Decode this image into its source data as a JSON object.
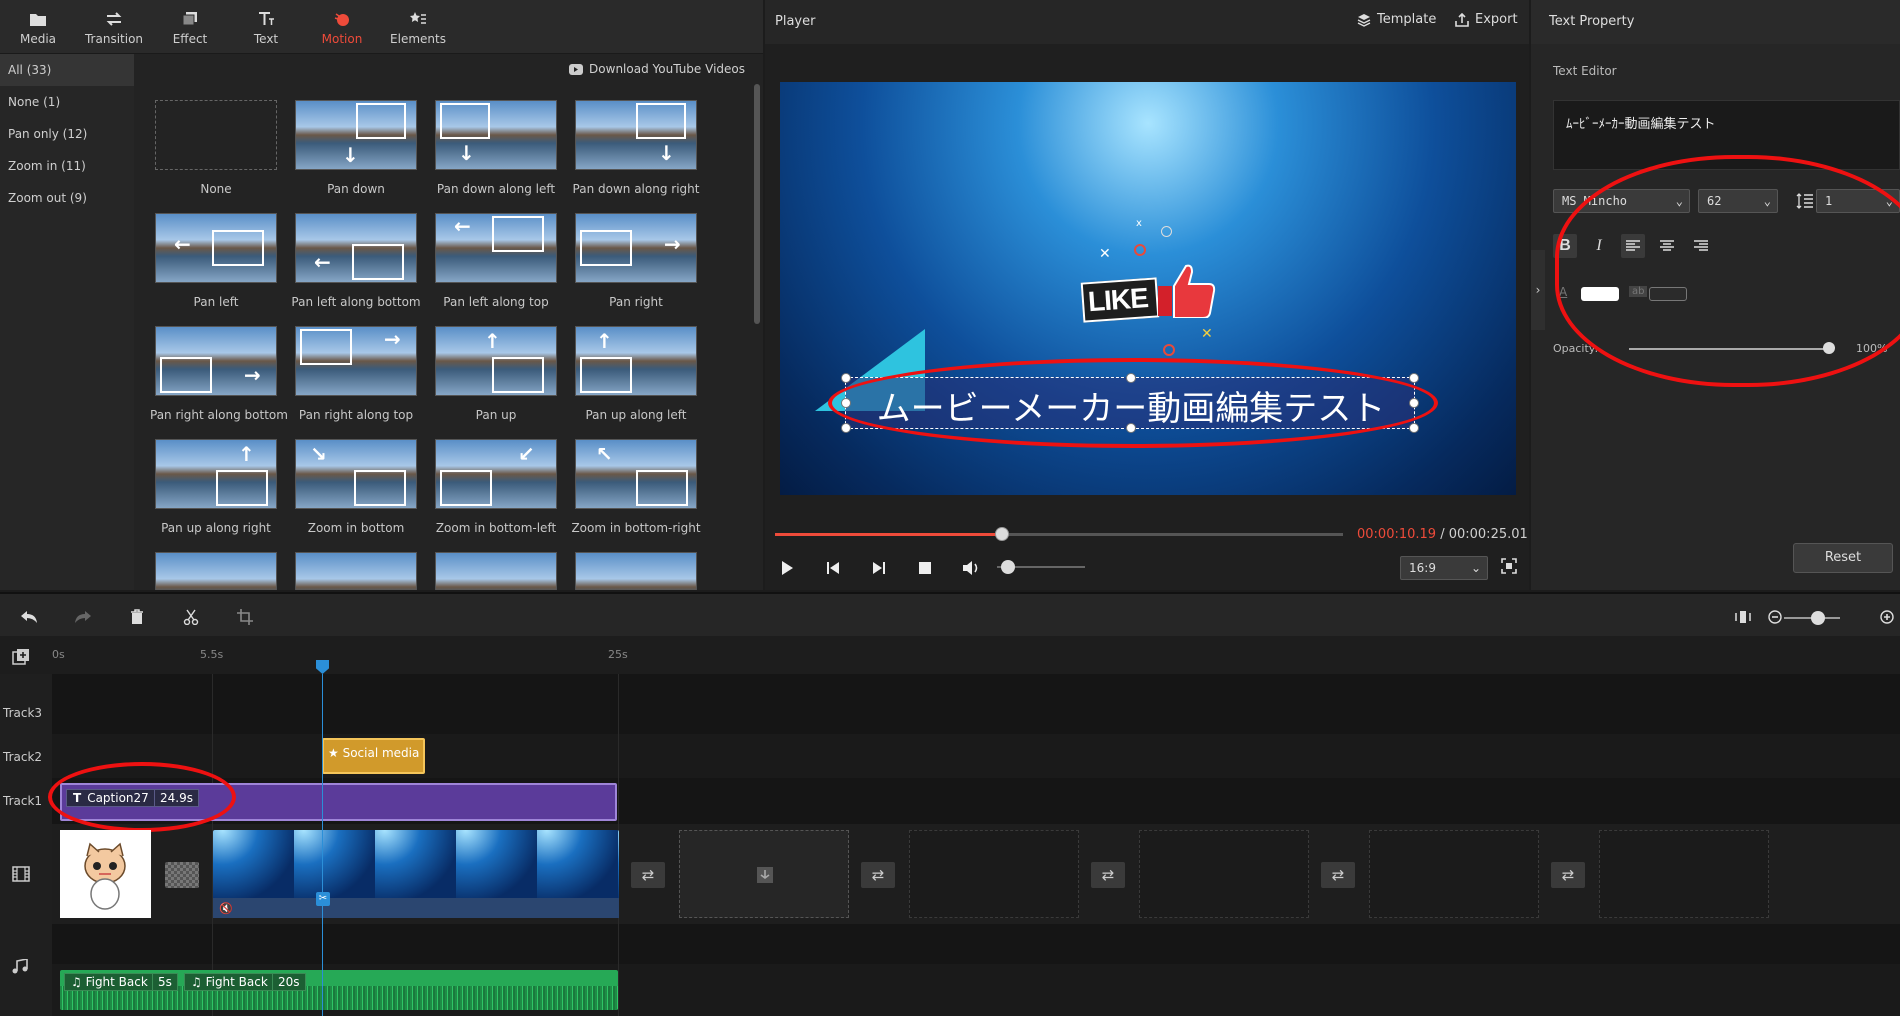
{
  "toolbar": {
    "items": [
      {
        "label": "Media",
        "icon": "folder-icon"
      },
      {
        "label": "Transition",
        "icon": "swap-icon"
      },
      {
        "label": "Effect",
        "icon": "layers-icon"
      },
      {
        "label": "Text",
        "icon": "text-icon"
      },
      {
        "label": "Motion",
        "icon": "motion-icon"
      },
      {
        "label": "Elements",
        "icon": "star-list-icon"
      }
    ],
    "active": "Motion",
    "active_color": "#ee4b3a"
  },
  "library": {
    "categories": [
      "All (33)",
      "None (1)",
      "Pan only (12)",
      "Zoom in (11)",
      "Zoom out (9)"
    ],
    "download_label": "Download YouTube Videos",
    "motions": [
      "None",
      "Pan down",
      "Pan down along left",
      "Pan down along right",
      "Pan left",
      "Pan left along bottom",
      "Pan left along top",
      "Pan right",
      "Pan right along bottom",
      "Pan right along top",
      "Pan up",
      "Pan up along left",
      "Pan up along right",
      "Zoom in bottom",
      "Zoom in bottom-left",
      "Zoom in bottom-right"
    ]
  },
  "player": {
    "title": "Player",
    "template_label": "Template",
    "export_label": "Export",
    "caption_text": "ムービーメーカー動画編集テスト",
    "sticker_text": "LIKE",
    "current_time": "00:00:10.19",
    "time_separator": " / ",
    "total_time": "00:00:25.01",
    "progress": 0.4,
    "volume": 0.05,
    "aspect_ratio": "16:9"
  },
  "text_property": {
    "title": "Text Property",
    "editor_label": "Text Editor",
    "editor_text": "ﾑｰﾋﾞｰﾒｰｶｰ動画編集テスト",
    "font": "MS Mincho",
    "size": "62",
    "line_spacing": "1",
    "text_color": "#ffffff",
    "bg_label": "ab",
    "opacity_label": "Opacity:",
    "opacity_value": "100%",
    "reset_label": "Reset"
  },
  "timeline": {
    "ticks": [
      "0s",
      "5.5s",
      "25s"
    ],
    "tracks": [
      "Track3",
      "Track2",
      "Track1"
    ],
    "caption_clip": {
      "name": "Caption27",
      "duration": "24.9s"
    },
    "social_clip": {
      "name": "Social media"
    },
    "audio_clips": [
      {
        "name": "Fight Back",
        "duration": "5s"
      },
      {
        "name": "Fight Back",
        "duration": "20s"
      }
    ],
    "zoom": 0.6
  }
}
